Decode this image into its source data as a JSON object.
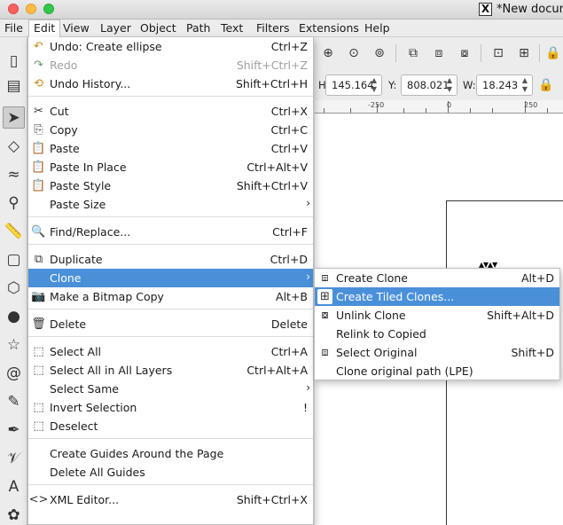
{
  "window": {
    "title": "*New docum"
  },
  "menubar": [
    "File",
    "Edit",
    "View",
    "Layer",
    "Object",
    "Path",
    "Text",
    "Filters",
    "Extensions",
    "Help"
  ],
  "toolbar": {
    "h_label": "H:",
    "h_value": "145.164",
    "y_label": "Y:",
    "y_value": "808.021",
    "w_label": "W:",
    "w_value": "18.243"
  },
  "ruler": {
    "labels": [
      "-250",
      "0",
      "250"
    ]
  },
  "edit_menu": {
    "undo": {
      "label": "Undo: Create ellipse",
      "shortcut": "Ctrl+Z"
    },
    "redo": {
      "label": "Redo",
      "shortcut": "Shift+Ctrl+Z"
    },
    "undo_history": {
      "label": "Undo History...",
      "shortcut": "Shift+Ctrl+H"
    },
    "cut": {
      "label": "Cut",
      "shortcut": "Ctrl+X"
    },
    "copy": {
      "label": "Copy",
      "shortcut": "Ctrl+C"
    },
    "paste": {
      "label": "Paste",
      "shortcut": "Ctrl+V"
    },
    "paste_in_place": {
      "label": "Paste In Place",
      "shortcut": "Ctrl+Alt+V"
    },
    "paste_style": {
      "label": "Paste Style",
      "shortcut": "Shift+Ctrl+V"
    },
    "paste_size": {
      "label": "Paste Size"
    },
    "find_replace": {
      "label": "Find/Replace...",
      "shortcut": "Ctrl+F"
    },
    "duplicate": {
      "label": "Duplicate",
      "shortcut": "Ctrl+D"
    },
    "clone": {
      "label": "Clone"
    },
    "make_bitmap_copy": {
      "label": "Make a Bitmap Copy",
      "shortcut": "Alt+B"
    },
    "delete": {
      "label": "Delete",
      "shortcut": "Delete"
    },
    "select_all": {
      "label": "Select All",
      "shortcut": "Ctrl+A"
    },
    "select_all_layers": {
      "label": "Select All in All Layers",
      "shortcut": "Ctrl+Alt+A"
    },
    "select_same": {
      "label": "Select Same"
    },
    "invert_selection": {
      "label": "Invert Selection",
      "shortcut": "!"
    },
    "deselect": {
      "label": "Deselect"
    },
    "create_guides": {
      "label": "Create Guides Around the Page"
    },
    "delete_guides": {
      "label": "Delete All Guides"
    },
    "xml_editor": {
      "label": "XML Editor...",
      "shortcut": "Shift+Ctrl+X"
    }
  },
  "clone_submenu": {
    "create_clone": {
      "label": "Create Clone",
      "shortcut": "Alt+D"
    },
    "create_tiled_clones": {
      "label": "Create Tiled Clones..."
    },
    "unlink_clone": {
      "label": "Unlink Clone",
      "shortcut": "Shift+Alt+D"
    },
    "relink_to_copied": {
      "label": "Relink to Copied"
    },
    "select_original": {
      "label": "Select Original",
      "shortcut": "Shift+D"
    },
    "clone_original_path": {
      "label": "Clone original path (LPE)"
    }
  },
  "colors": {
    "highlight": "#4a90d9",
    "menu_bg": "#ffffff",
    "chrome_bg": "#ececec"
  }
}
